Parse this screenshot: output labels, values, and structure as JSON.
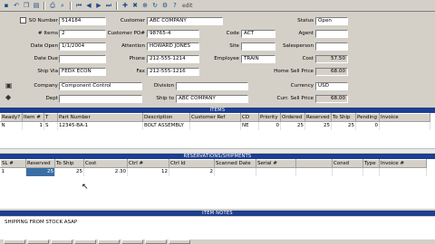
{
  "toolbar": {
    "icons": [
      "save-icon",
      "undo-icon",
      "copy-icon",
      "paste-icon",
      "print-icon",
      "find-icon",
      "prev-icon",
      "next-icon",
      "first-icon",
      "last-icon",
      "new-icon",
      "delete-icon",
      "zoom-icon",
      "refresh-icon",
      "settings-icon",
      "help-icon"
    ],
    "edit_label": "edit"
  },
  "order": {
    "so_number_label": "SO Number",
    "so_number": "514184",
    "items_label": "# Items",
    "items": "2",
    "date_open_label": "Date Open",
    "date_open": "1/1/2004",
    "date_due_label": "Date Due",
    "date_due": "",
    "ship_via_label": "Ship Via",
    "ship_via": "FEDX ECON",
    "company_label": "Company",
    "company": "Component Control",
    "dept_label": "Dept",
    "customer_label": "Customer",
    "customer": "ABC COMPANY",
    "customer_po_label": "Customer PO#",
    "customer_po": "98765-4",
    "attention_label": "Attention",
    "attention": "HOWARD JONES",
    "phone_label": "Phone",
    "phone": "212-555-1214",
    "fax_label": "Fax",
    "fax": "212-555-1216",
    "division_label": "Division",
    "division": "",
    "ship_to_label": "Ship to",
    "ship_to": "ABC COMPANY",
    "code_label": "Code",
    "code": "ACT",
    "site_label": "Site",
    "site": "",
    "employee_label": "Employee",
    "employee": "TRAIN",
    "status_label": "Status",
    "status": "Open",
    "agent_label": "Agent",
    "agent": "",
    "salesperson_label": "Salesperson",
    "salesperson": "",
    "cost_label": "Cost",
    "cost": "57.50",
    "home_sell_price_label": "Home Sell Price",
    "home_sell_price": "68.00",
    "currency_label": "Currency",
    "currency": "USD",
    "cur_sell_price_label": "Curr. Sell Price",
    "cur_sell_price": "68.00"
  },
  "items": {
    "title": "ITEMS",
    "columns": [
      "Ready?",
      "Item #",
      "T",
      "Part Number",
      "Description",
      "Customer Ref",
      "CD",
      "Priority",
      "Ordered",
      "Reserved",
      "To Ship",
      "Pending",
      "Invoice"
    ],
    "rows": [
      [
        "N",
        "1",
        "S",
        "12345-BA-1",
        "BOLT ASSEMBLY",
        "",
        "NE",
        "0",
        "25",
        "25",
        "25",
        "0",
        ""
      ]
    ]
  },
  "reservations": {
    "title": "RESERVATIONS/SHIPMENTS",
    "columns": [
      "SL #",
      "Reserved",
      "To Ship",
      "Cost",
      "Ctrl #",
      "Ctrl Id",
      "Scanned Date",
      "Serial #",
      "",
      "Consd",
      "Type",
      "Invoice #"
    ],
    "rows": [
      [
        "1",
        "25",
        "25",
        "2.30",
        "12",
        "2",
        "",
        "",
        "",
        "",
        "",
        ""
      ]
    ]
  },
  "notes": {
    "title": "ITEM NOTES",
    "text": "SHIPPING FROM STOCK ASAP"
  },
  "colors": {
    "section_bar": "#1e3f8f",
    "selected_cell": "#3a6ea5"
  }
}
